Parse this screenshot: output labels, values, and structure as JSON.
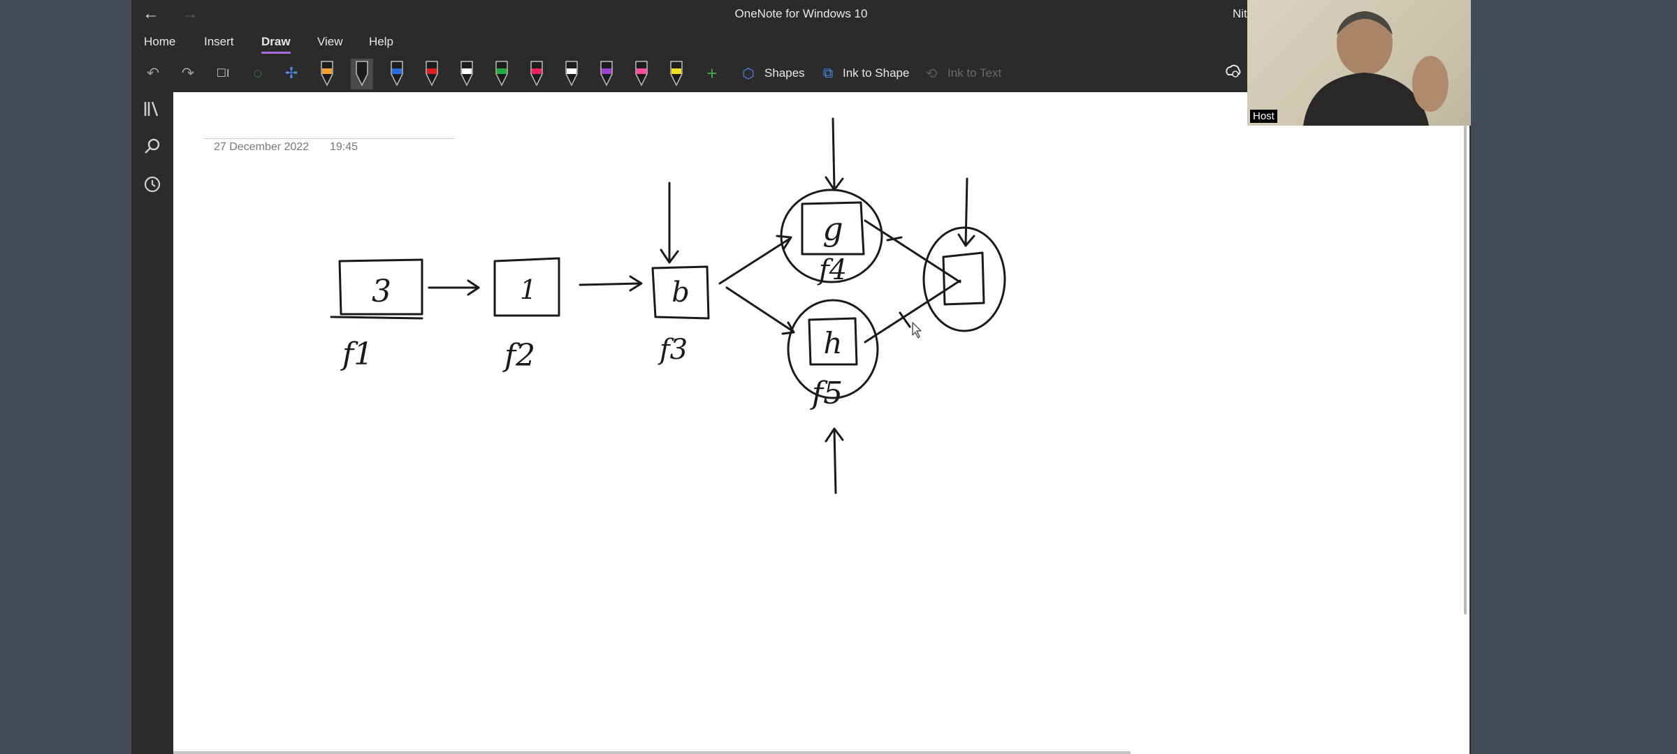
{
  "window": {
    "title": "OneNote for Windows 10",
    "user_initials": "Nit"
  },
  "menu": {
    "items": [
      "Home",
      "Insert",
      "Draw",
      "View",
      "Help"
    ],
    "active": "Draw"
  },
  "toolbar": {
    "shapes_label": "Shapes",
    "ink_to_shape_label": "Ink to Shape",
    "ink_to_text_label": "Ink to Text"
  },
  "pens": [
    "#f0a030",
    "#1a1a1a",
    "#2b6ce0",
    "#e02020",
    "#ffffff",
    "#22aa44",
    "#ee2255",
    "#ffffff",
    "#a040d0",
    "#ff4aa0",
    "#f0e020"
  ],
  "note": {
    "date": "27 December 2022",
    "time": "19:45"
  },
  "drawing": {
    "box_labels": [
      "3",
      "1",
      "b",
      "g",
      "h"
    ],
    "function_labels": [
      "f1",
      "f2",
      "f3",
      "f4",
      "f5"
    ]
  },
  "webcam": {
    "label": "Host"
  }
}
